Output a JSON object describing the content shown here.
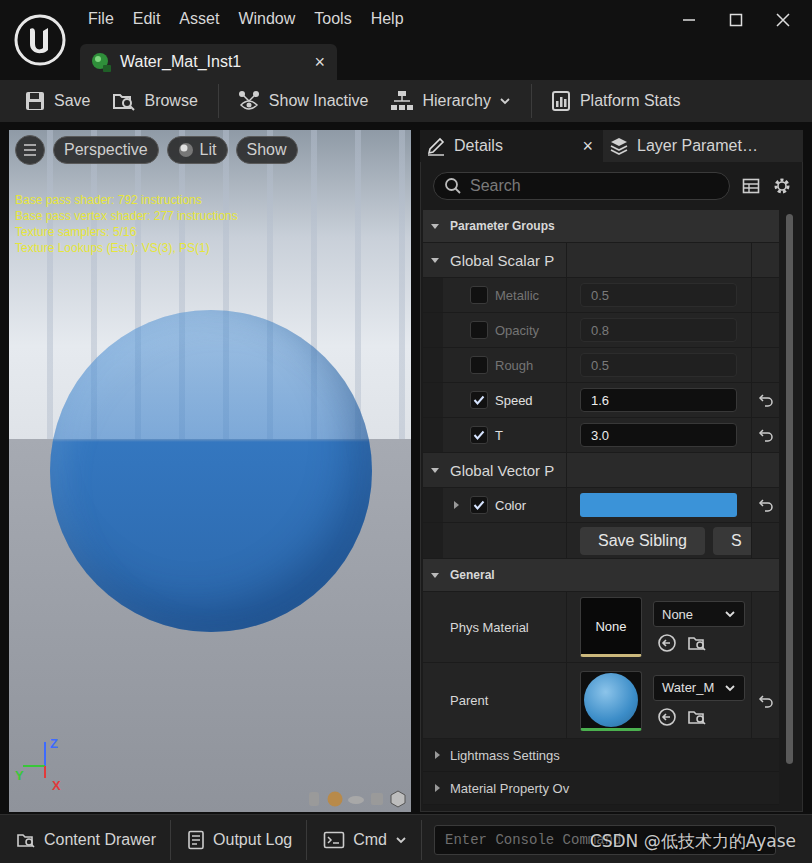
{
  "window": {
    "menu": [
      "File",
      "Edit",
      "Asset",
      "Window",
      "Tools",
      "Help"
    ],
    "tab": {
      "label": "Water_Mat_Inst1",
      "close": "×",
      "selected": true
    }
  },
  "toolbar": [
    [
      {
        "label": "Save",
        "dropdown": false
      },
      {
        "label": "Browse",
        "dropdown": false
      }
    ],
    [
      {
        "label": "Show Inactive",
        "dropdown": false
      },
      {
        "label": "Hierarchy",
        "dropdown": true
      }
    ],
    [
      {
        "label": "Platform Stats",
        "dropdown": false
      }
    ]
  ],
  "viewport": {
    "buttons": [
      {
        "label": "Perspective",
        "kind": "text"
      },
      {
        "label": "Lit",
        "kind": "lit"
      },
      {
        "label": "Show",
        "kind": "text"
      }
    ],
    "stats": [
      "Base pass shader: 792 instructions",
      "Base pass vertex shader: 277 instructions",
      "Texture samplers: 5/16",
      "Texture Lookups (Est.): VS(3), PS(1)"
    ],
    "axes": [
      {
        "label": "Z",
        "color": "#3d6bff"
      },
      {
        "label": "Y",
        "color": "#39c739"
      },
      {
        "label": "X",
        "color": "#e23a3a"
      }
    ]
  },
  "details": {
    "tabs": [
      {
        "label": "Details",
        "selected": true,
        "close": "×"
      },
      {
        "label": "Layer Paramet…",
        "selected": false
      }
    ],
    "search": {
      "placeholder": "Search"
    },
    "parameter_groups": {
      "label": "Parameter Groups",
      "expanded": true,
      "groups": [
        {
          "label": "Global Scalar P",
          "expanded": true,
          "params": [
            {
              "name": "Metallic",
              "kind": "scalar",
              "checked": false,
              "value": "0.5"
            },
            {
              "name": "Opacity",
              "kind": "scalar",
              "checked": false,
              "value": "0.8"
            },
            {
              "name": "Rough",
              "kind": "scalar",
              "checked": false,
              "value": "0.5"
            },
            {
              "name": "Speed",
              "kind": "scalar",
              "checked": true,
              "value": "1.6"
            },
            {
              "name": "T",
              "kind": "scalar",
              "checked": true,
              "value": "3.0"
            }
          ]
        },
        {
          "label": "Global Vector P",
          "expanded": true,
          "params": [
            {
              "name": "Color",
              "kind": "vector",
              "checked": true,
              "expanded": false,
              "color": "#3b93d8"
            }
          ]
        }
      ]
    },
    "sibling_buttons": [
      "Save Sibling",
      "S"
    ],
    "general": {
      "label": "General",
      "expanded": true,
      "rows": [
        {
          "name": "Phys Material",
          "kind": "none",
          "thumb": "None",
          "value": "None",
          "resettable": false
        },
        {
          "name": "Parent",
          "kind": "material",
          "value": "Water_M",
          "resettable": true
        }
      ]
    },
    "collapsed_sections": [
      {
        "label": "Lightmass Settings",
        "expanded": false
      },
      {
        "label": "Material Property Ov",
        "expanded": false
      }
    ]
  },
  "bottom_bar": {
    "items": [
      {
        "label": "Content Drawer",
        "dropdown": false
      },
      {
        "label": "Output Log",
        "dropdown": false
      },
      {
        "label": "Cmd",
        "dropdown": true
      }
    ],
    "console_placeholder": "Enter Console Command"
  },
  "watermark": "CSDN @低技术力的Ayase"
}
